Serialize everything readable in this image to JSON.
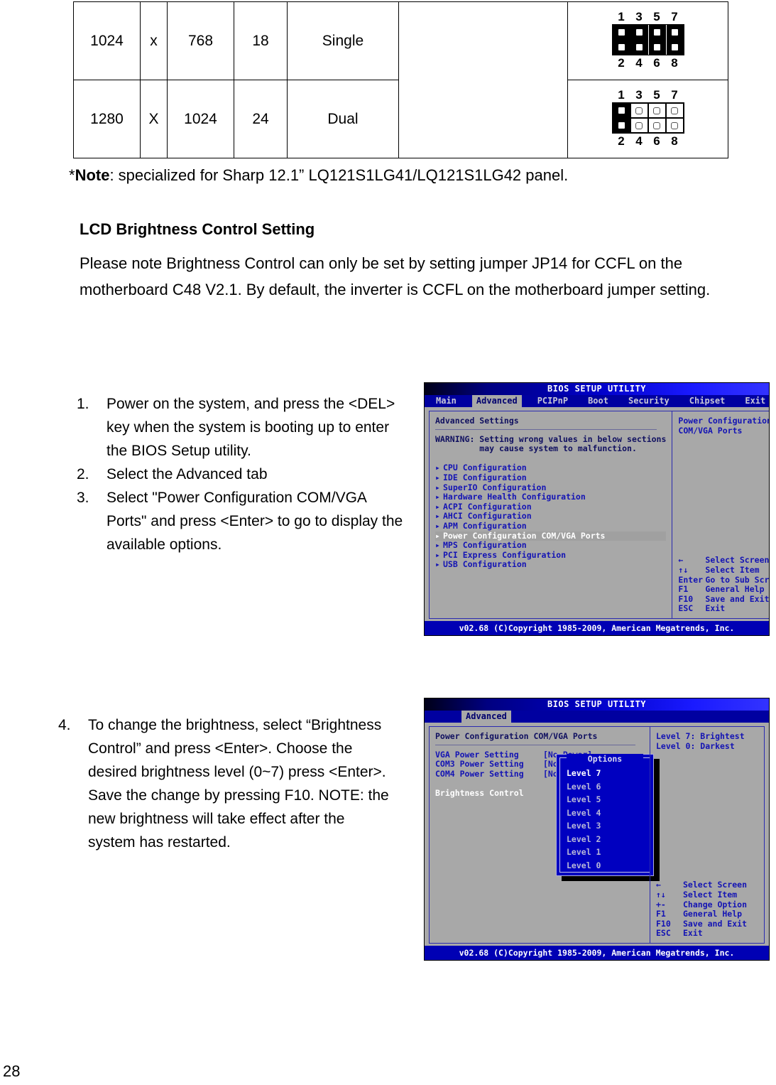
{
  "resolution_table": {
    "rows": [
      {
        "width": "1024",
        "separator": "x",
        "height": "768",
        "bpp": "18",
        "channel": "Single",
        "blank": "",
        "jumper": {
          "top_labels": [
            "1",
            "3",
            "5",
            "7"
          ],
          "bottom_labels": [
            "2",
            "4",
            "6",
            "8"
          ],
          "style": "all-closed"
        }
      },
      {
        "width": "1280",
        "separator": "X",
        "height": "1024",
        "bpp": "24",
        "channel": "Dual",
        "blank": "",
        "jumper": {
          "top_labels": [
            "1",
            "3",
            "5",
            "7"
          ],
          "bottom_labels": [
            "2",
            "4",
            "6",
            "8"
          ],
          "style": "first-closed"
        }
      }
    ]
  },
  "note": {
    "marker": "*",
    "label": "Note",
    "text": ": specialized for Sharp 12.1” LQ121S1LG41/LQ121S1LG42 panel."
  },
  "section": {
    "heading": "LCD Brightness Control Setting",
    "paragraph": "Please note Brightness Control can only be set by setting jumper JP14 for CCFL on the motherboard C48 V2.1.    By default, the inverter is CCFL on the motherboard jumper setting."
  },
  "steps_a": [
    {
      "num": "1.",
      "text": "Power on the system, and press the <DEL> key when the system is booting up to enter the BIOS Setup utility."
    },
    {
      "num": "2.",
      "text": "Select the Advanced tab"
    },
    {
      "num": "3.",
      "text": "Select \"Power Configuration COM/VGA Ports\" and press <Enter> to go to display the available options."
    }
  ],
  "steps_b": [
    {
      "num": "4.",
      "text": "To change the brightness, select “Brightness Control” and press <Enter>. Choose the desired brightness level (0~7) press <Enter>. Save the change by pressing F10. NOTE: the new brightness will take effect after the system has restarted."
    }
  ],
  "page_number": "28",
  "bios1": {
    "title": "BIOS SETUP UTILITY",
    "menu": [
      "Main",
      "Advanced",
      "PCIPnP",
      "Boot",
      "Security",
      "Chipset",
      "Exit"
    ],
    "active_menu": "Advanced",
    "heading": "Advanced Settings",
    "warning_line1": "WARNING: Setting wrong values in below sections",
    "warning_line2": "         may cause system to malfunction.",
    "items": [
      "CPU Configuration",
      "IDE Configuration",
      "SuperIO Configuration",
      "Hardware Health Configuration",
      "ACPI Configuration",
      "AHCI Configuration",
      "APM Configuration",
      "Power Configuration COM/VGA Ports",
      "MPS Configuration",
      "PCI Express Configuration",
      "USB Configuration"
    ],
    "selected_item": "Power Configuration COM/VGA Ports",
    "help_title_line1": "Power Configuration",
    "help_title_line2": "COM/VGA Ports",
    "keys": [
      {
        "key": "←",
        "desc": "Select Screen"
      },
      {
        "key": "↑↓",
        "desc": "Select Item"
      },
      {
        "key": "Enter",
        "desc": "Go to Sub Screen"
      },
      {
        "key": "F1",
        "desc": "General Help"
      },
      {
        "key": "F10",
        "desc": "Save and Exit"
      },
      {
        "key": "ESC",
        "desc": "Exit"
      }
    ],
    "footer": "v02.68 (C)Copyright 1985-2009, American Megatrends, Inc."
  },
  "bios2": {
    "title": "BIOS SETUP UTILITY",
    "menu": [
      "Advanced"
    ],
    "active_menu": "Advanced",
    "heading": "Power Configuration COM/VGA Ports",
    "settings": [
      {
        "label": "VGA Power Setting",
        "value": "[No Power]"
      },
      {
        "label": "COM3 Power Setting",
        "value": "[None]"
      },
      {
        "label": "COM4 Power Setting",
        "value": "[None]"
      }
    ],
    "highlighted_setting": "Brightness Control",
    "options_title": "Options",
    "options": [
      "Level 7",
      "Level 6",
      "Level 5",
      "Level 4",
      "Level 3",
      "Level 2",
      "Level 1",
      "Level 0"
    ],
    "selected_option": "Level 7",
    "help_line1": "Level 7: Brightest",
    "help_line2": "Level 0: Darkest",
    "keys": [
      {
        "key": "←",
        "desc": "Select Screen"
      },
      {
        "key": "↑↓",
        "desc": "Select Item"
      },
      {
        "key": "+-",
        "desc": "Change Option"
      },
      {
        "key": "F1",
        "desc": "General Help"
      },
      {
        "key": "F10",
        "desc": "Save and Exit"
      },
      {
        "key": "ESC",
        "desc": "Exit"
      }
    ],
    "footer": "v02.68 (C)Copyright 1985-2009, American Megatrends, Inc."
  },
  "colors": {
    "bios_bg": "#a8a8a8",
    "bios_blue": "#0000b4",
    "bios_text": "#1414b4",
    "highlight_white": "#ffffff"
  }
}
